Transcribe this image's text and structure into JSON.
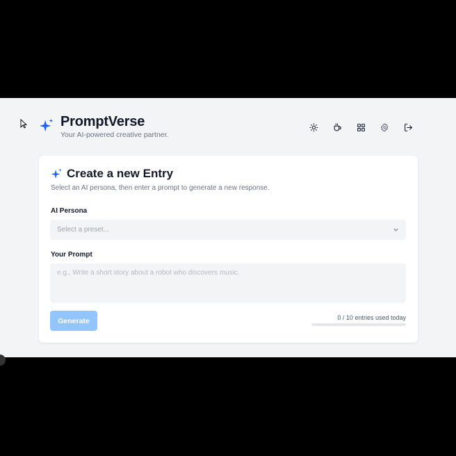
{
  "app": {
    "title": "PromptVerse",
    "tagline": "Your AI-powered creative partner."
  },
  "toolbar": {
    "icons": [
      "sun-icon",
      "coffee-icon",
      "grid-icon",
      "gear-icon",
      "logout-icon"
    ]
  },
  "card": {
    "title": "Create a new Entry",
    "subtitle": "Select an AI persona, then enter a prompt to generate a new response.",
    "persona_label": "AI Persona",
    "persona_placeholder": "Select a preset...",
    "prompt_label": "Your Prompt",
    "prompt_placeholder": "e.g., Write a short story about a robot who discovers music.",
    "generate_label": "Generate",
    "usage_text": "0 / 10 entries used today",
    "usage_fraction": 0
  },
  "colors": {
    "accent": "#3b82f6",
    "button_disabled": "#93c5fd",
    "background": "#f3f4f6"
  }
}
